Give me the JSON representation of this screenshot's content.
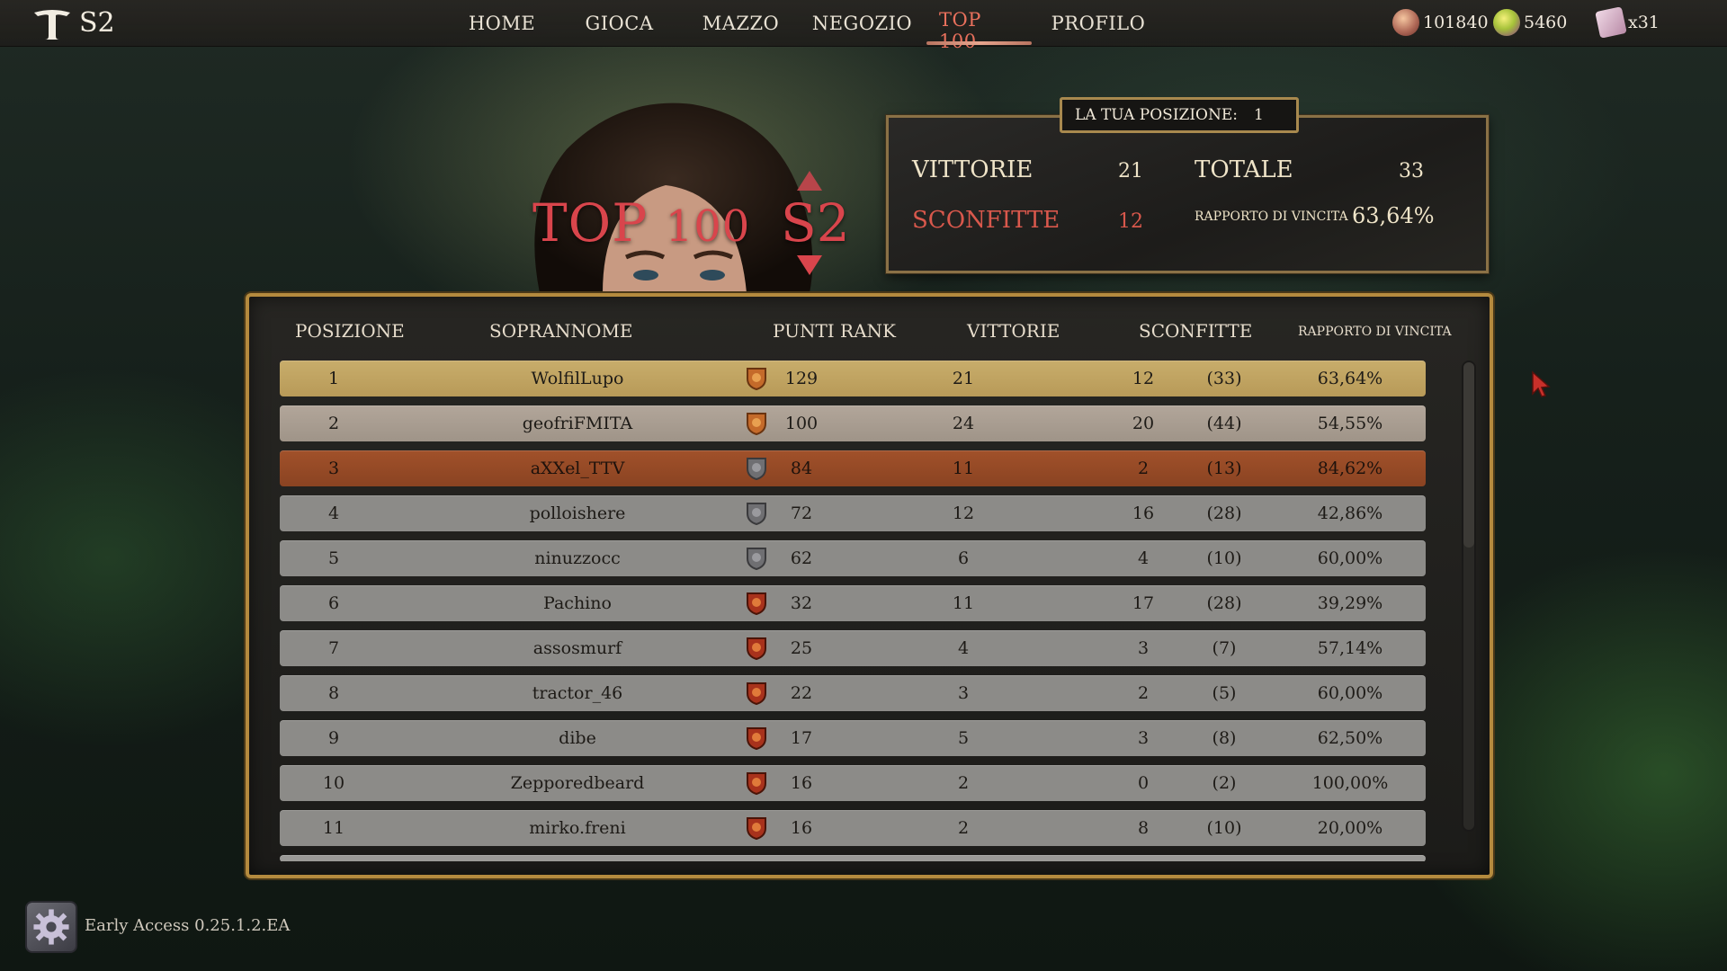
{
  "header": {
    "season_tag": "S2",
    "nav": [
      {
        "label": "HOME"
      },
      {
        "label": "GIOCA"
      },
      {
        "label": "MAZZO"
      },
      {
        "label": "NEGOZIO"
      },
      {
        "label": "TOP 100",
        "active": true
      },
      {
        "label": "PROFILO"
      }
    ],
    "currencies": [
      {
        "icon": "gold-pouch-icon",
        "value": "101840"
      },
      {
        "icon": "gem-icon",
        "value": "5460"
      },
      {
        "icon": "scroll-icon",
        "value": "x31"
      }
    ]
  },
  "hero": {
    "title_main": "TOP",
    "title_num": "100",
    "season": "S2"
  },
  "stats": {
    "position_label": "LA TUA POSIZIONE:",
    "position_value": "1",
    "wins_label": "VITTORIE",
    "wins_value": "21",
    "losses_label": "SCONFITTE",
    "losses_value": "12",
    "total_label": "TOTALE",
    "total_value": "33",
    "ratio_label": "RAPPORTO DI VINCITA",
    "ratio_value": "63,64%"
  },
  "leaderboard": {
    "headers": {
      "position": "POSIZIONE",
      "nickname": "SOPRANNOME",
      "points": "PUNTI RANK",
      "wins": "VITTORIE",
      "losses": "SCONFITTE",
      "ratio": "RAPPORTO DI VINCITA"
    },
    "rows": [
      {
        "pos": "1",
        "nick": "WolfilLupo",
        "badge": "bronze-shield-badge-icon",
        "pts": "129",
        "wins": "21",
        "losses": "12",
        "total": "(33)",
        "ratio": "63,64%"
      },
      {
        "pos": "2",
        "nick": "geofriFMITA",
        "badge": "bronze-shield-badge-icon",
        "pts": "100",
        "wins": "24",
        "losses": "20",
        "total": "(44)",
        "ratio": "54,55%"
      },
      {
        "pos": "3",
        "nick": "aXXel_TTV",
        "badge": "gray-shield-badge-icon",
        "pts": "84",
        "wins": "11",
        "losses": "2",
        "total": "(13)",
        "ratio": "84,62%"
      },
      {
        "pos": "4",
        "nick": "polloishere",
        "badge": "gray-shield-badge-icon",
        "pts": "72",
        "wins": "12",
        "losses": "16",
        "total": "(28)",
        "ratio": "42,86%"
      },
      {
        "pos": "5",
        "nick": "ninuzzocc",
        "badge": "gray-shield-badge-icon",
        "pts": "62",
        "wins": "6",
        "losses": "4",
        "total": "(10)",
        "ratio": "60,00%"
      },
      {
        "pos": "6",
        "nick": "Pachino",
        "badge": "red-shield-badge-icon",
        "pts": "32",
        "wins": "11",
        "losses": "17",
        "total": "(28)",
        "ratio": "39,29%"
      },
      {
        "pos": "7",
        "nick": "assosmurf",
        "badge": "red-shield-badge-icon",
        "pts": "25",
        "wins": "4",
        "losses": "3",
        "total": "(7)",
        "ratio": "57,14%"
      },
      {
        "pos": "8",
        "nick": "tractor_46",
        "badge": "red-shield-badge-icon",
        "pts": "22",
        "wins": "3",
        "losses": "2",
        "total": "(5)",
        "ratio": "60,00%"
      },
      {
        "pos": "9",
        "nick": "dibe",
        "badge": "red-shield-badge-icon",
        "pts": "17",
        "wins": "5",
        "losses": "3",
        "total": "(8)",
        "ratio": "62,50%"
      },
      {
        "pos": "10",
        "nick": "Zepporedbeard",
        "badge": "red-shield-badge-icon",
        "pts": "16",
        "wins": "2",
        "losses": "0",
        "total": "(2)",
        "ratio": "100,00%"
      },
      {
        "pos": "11",
        "nick": "mirko.freni",
        "badge": "red-shield-badge-icon",
        "pts": "16",
        "wins": "2",
        "losses": "8",
        "total": "(10)",
        "ratio": "20,00%"
      }
    ]
  },
  "footer": {
    "version": "Early Access 0.25.1.2.EA"
  }
}
